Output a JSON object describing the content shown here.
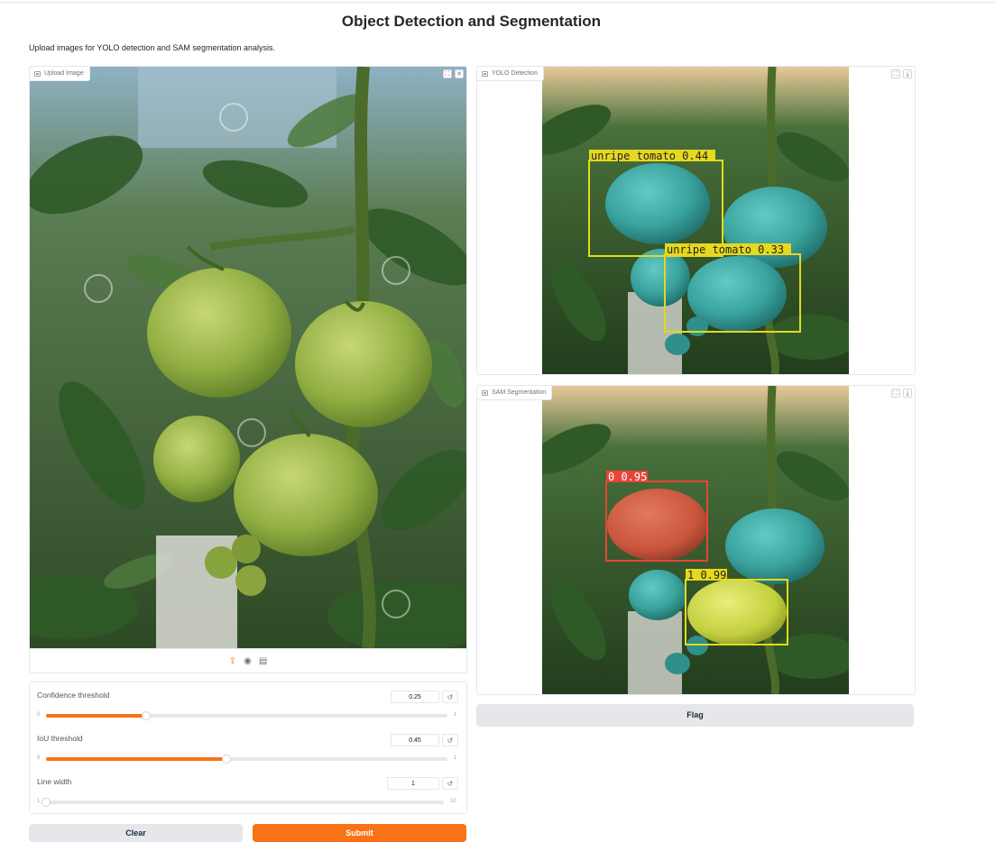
{
  "page": {
    "title": "Object Detection and Segmentation",
    "description": "Upload images for YOLO detection and SAM segmentation analysis."
  },
  "upload": {
    "label": "Upload Image",
    "sources": [
      "upload-icon",
      "webcam-icon",
      "clipboard-icon"
    ]
  },
  "yolo": {
    "label": "YOLO Detection",
    "detections": [
      {
        "text": "unripe tomato 0.44",
        "color": "#e6d81e"
      },
      {
        "text": "unripe tomato 0.33",
        "color": "#e6d81e"
      }
    ]
  },
  "sam": {
    "label": "SAM Segmentation",
    "detections": [
      {
        "text": "0 0.95",
        "color": "#e8453a"
      },
      {
        "text": "1 0.99",
        "color": "#e6d81e"
      }
    ]
  },
  "controls": {
    "confidence": {
      "label": "Confidence threshold",
      "value": "0.25",
      "min": "0",
      "max": "1",
      "fraction": 0.25
    },
    "iou": {
      "label": "IoU threshold",
      "value": "0.45",
      "min": "0",
      "max": "1",
      "fraction": 0.45
    },
    "line_width": {
      "label": "Line width",
      "value": "1",
      "min": "1",
      "max": "10",
      "fraction": 0.0
    }
  },
  "buttons": {
    "flag": "Flag",
    "clear": "Clear",
    "submit": "Submit"
  },
  "colors": {
    "accent": "#f97316",
    "leaf": "#3d6b33",
    "unripe_tomato": "#9ab64a",
    "teal_tomato": "#3aa39e"
  }
}
